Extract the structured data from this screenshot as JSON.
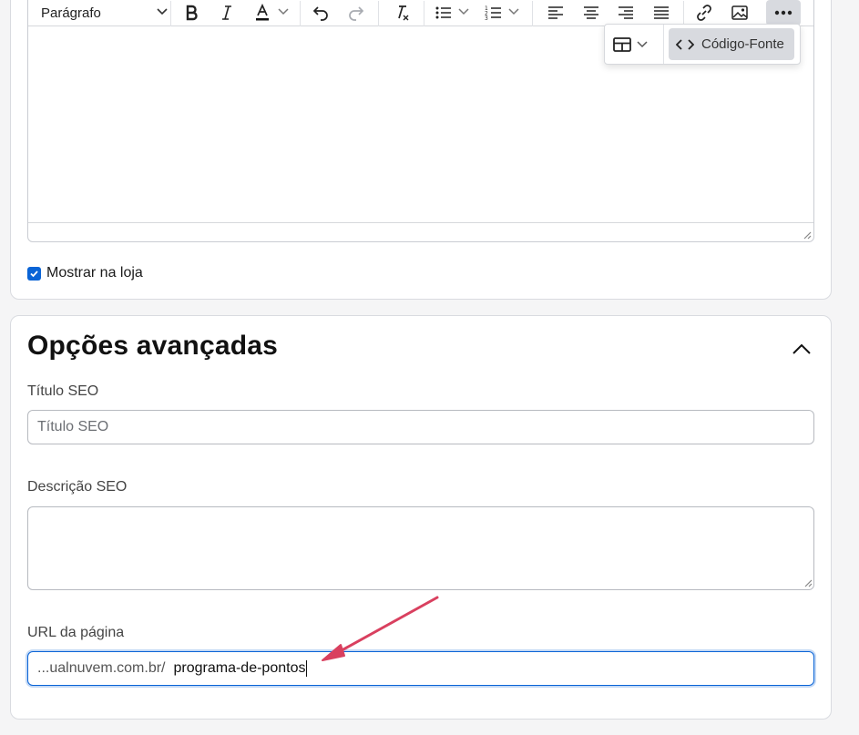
{
  "editor": {
    "paragraph_select": "Parágrafo",
    "popup_code_label": "Código-Fonte"
  },
  "show_in_store": {
    "label": "Mostrar na loja",
    "checked": true
  },
  "advanced": {
    "title": "Opções avançadas",
    "seo_title_label": "Título SEO",
    "seo_title_placeholder": "Título SEO",
    "seo_description_label": "Descrição SEO",
    "url_label": "URL da página",
    "url_prefix": "...ualnuvem.com.br/",
    "url_value": "programa-de-pontos"
  },
  "colors": {
    "accent": "#0a64d6",
    "annotation_arrow": "#d9405f"
  }
}
